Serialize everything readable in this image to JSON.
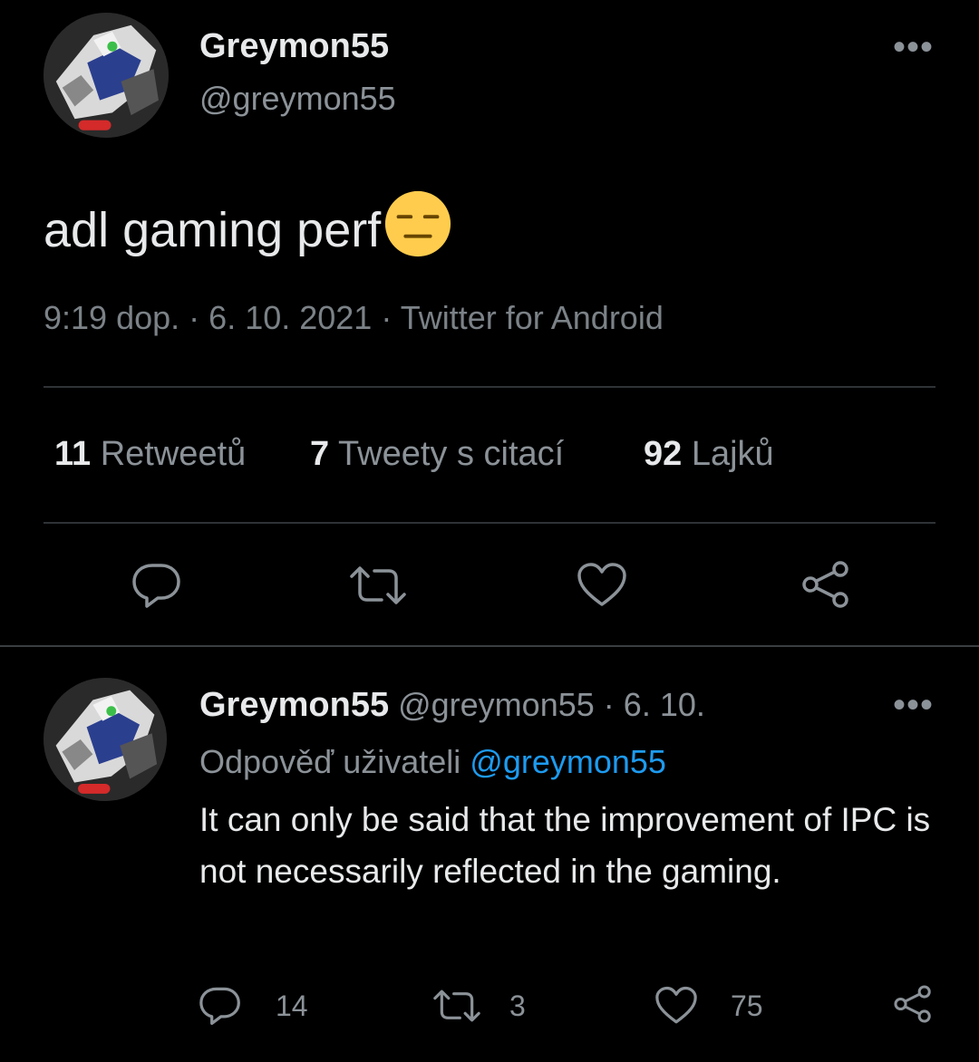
{
  "main_tweet": {
    "author_name": "Greymon55",
    "author_handle": "@greymon55",
    "more_label": "•••",
    "text": "adl gaming perf",
    "emoji": "expressionless-face",
    "time": "9:19 dop.",
    "date": "6. 10. 2021",
    "source": "Twitter for Android",
    "separator": "·",
    "stats": {
      "retweets_count": "11",
      "retweets_label": "Retweetů",
      "quotes_count": "7",
      "quotes_label": "Tweety s citací",
      "likes_count": "92",
      "likes_label": "Lajků"
    },
    "actions": [
      "reply-icon",
      "retweet-icon",
      "like-icon",
      "share-icon"
    ]
  },
  "reply_tweet": {
    "author_name": "Greymon55",
    "author_handle": "@greymon55",
    "separator": "·",
    "date": "6. 10.",
    "more_label": "•••",
    "replying_to_label": "Odpověď uživateli",
    "replying_to_handle": "@greymon55",
    "text": "It can only be said that the improvement of IPC is not necessarily reflected in the gaming.",
    "reply_count": "14",
    "retweet_count": "3",
    "like_count": "75"
  },
  "colors": {
    "background": "#000000",
    "text": "#e7e9ea",
    "secondary": "#8b9298",
    "link": "#1d9bf0",
    "divider": "#2f3336"
  }
}
